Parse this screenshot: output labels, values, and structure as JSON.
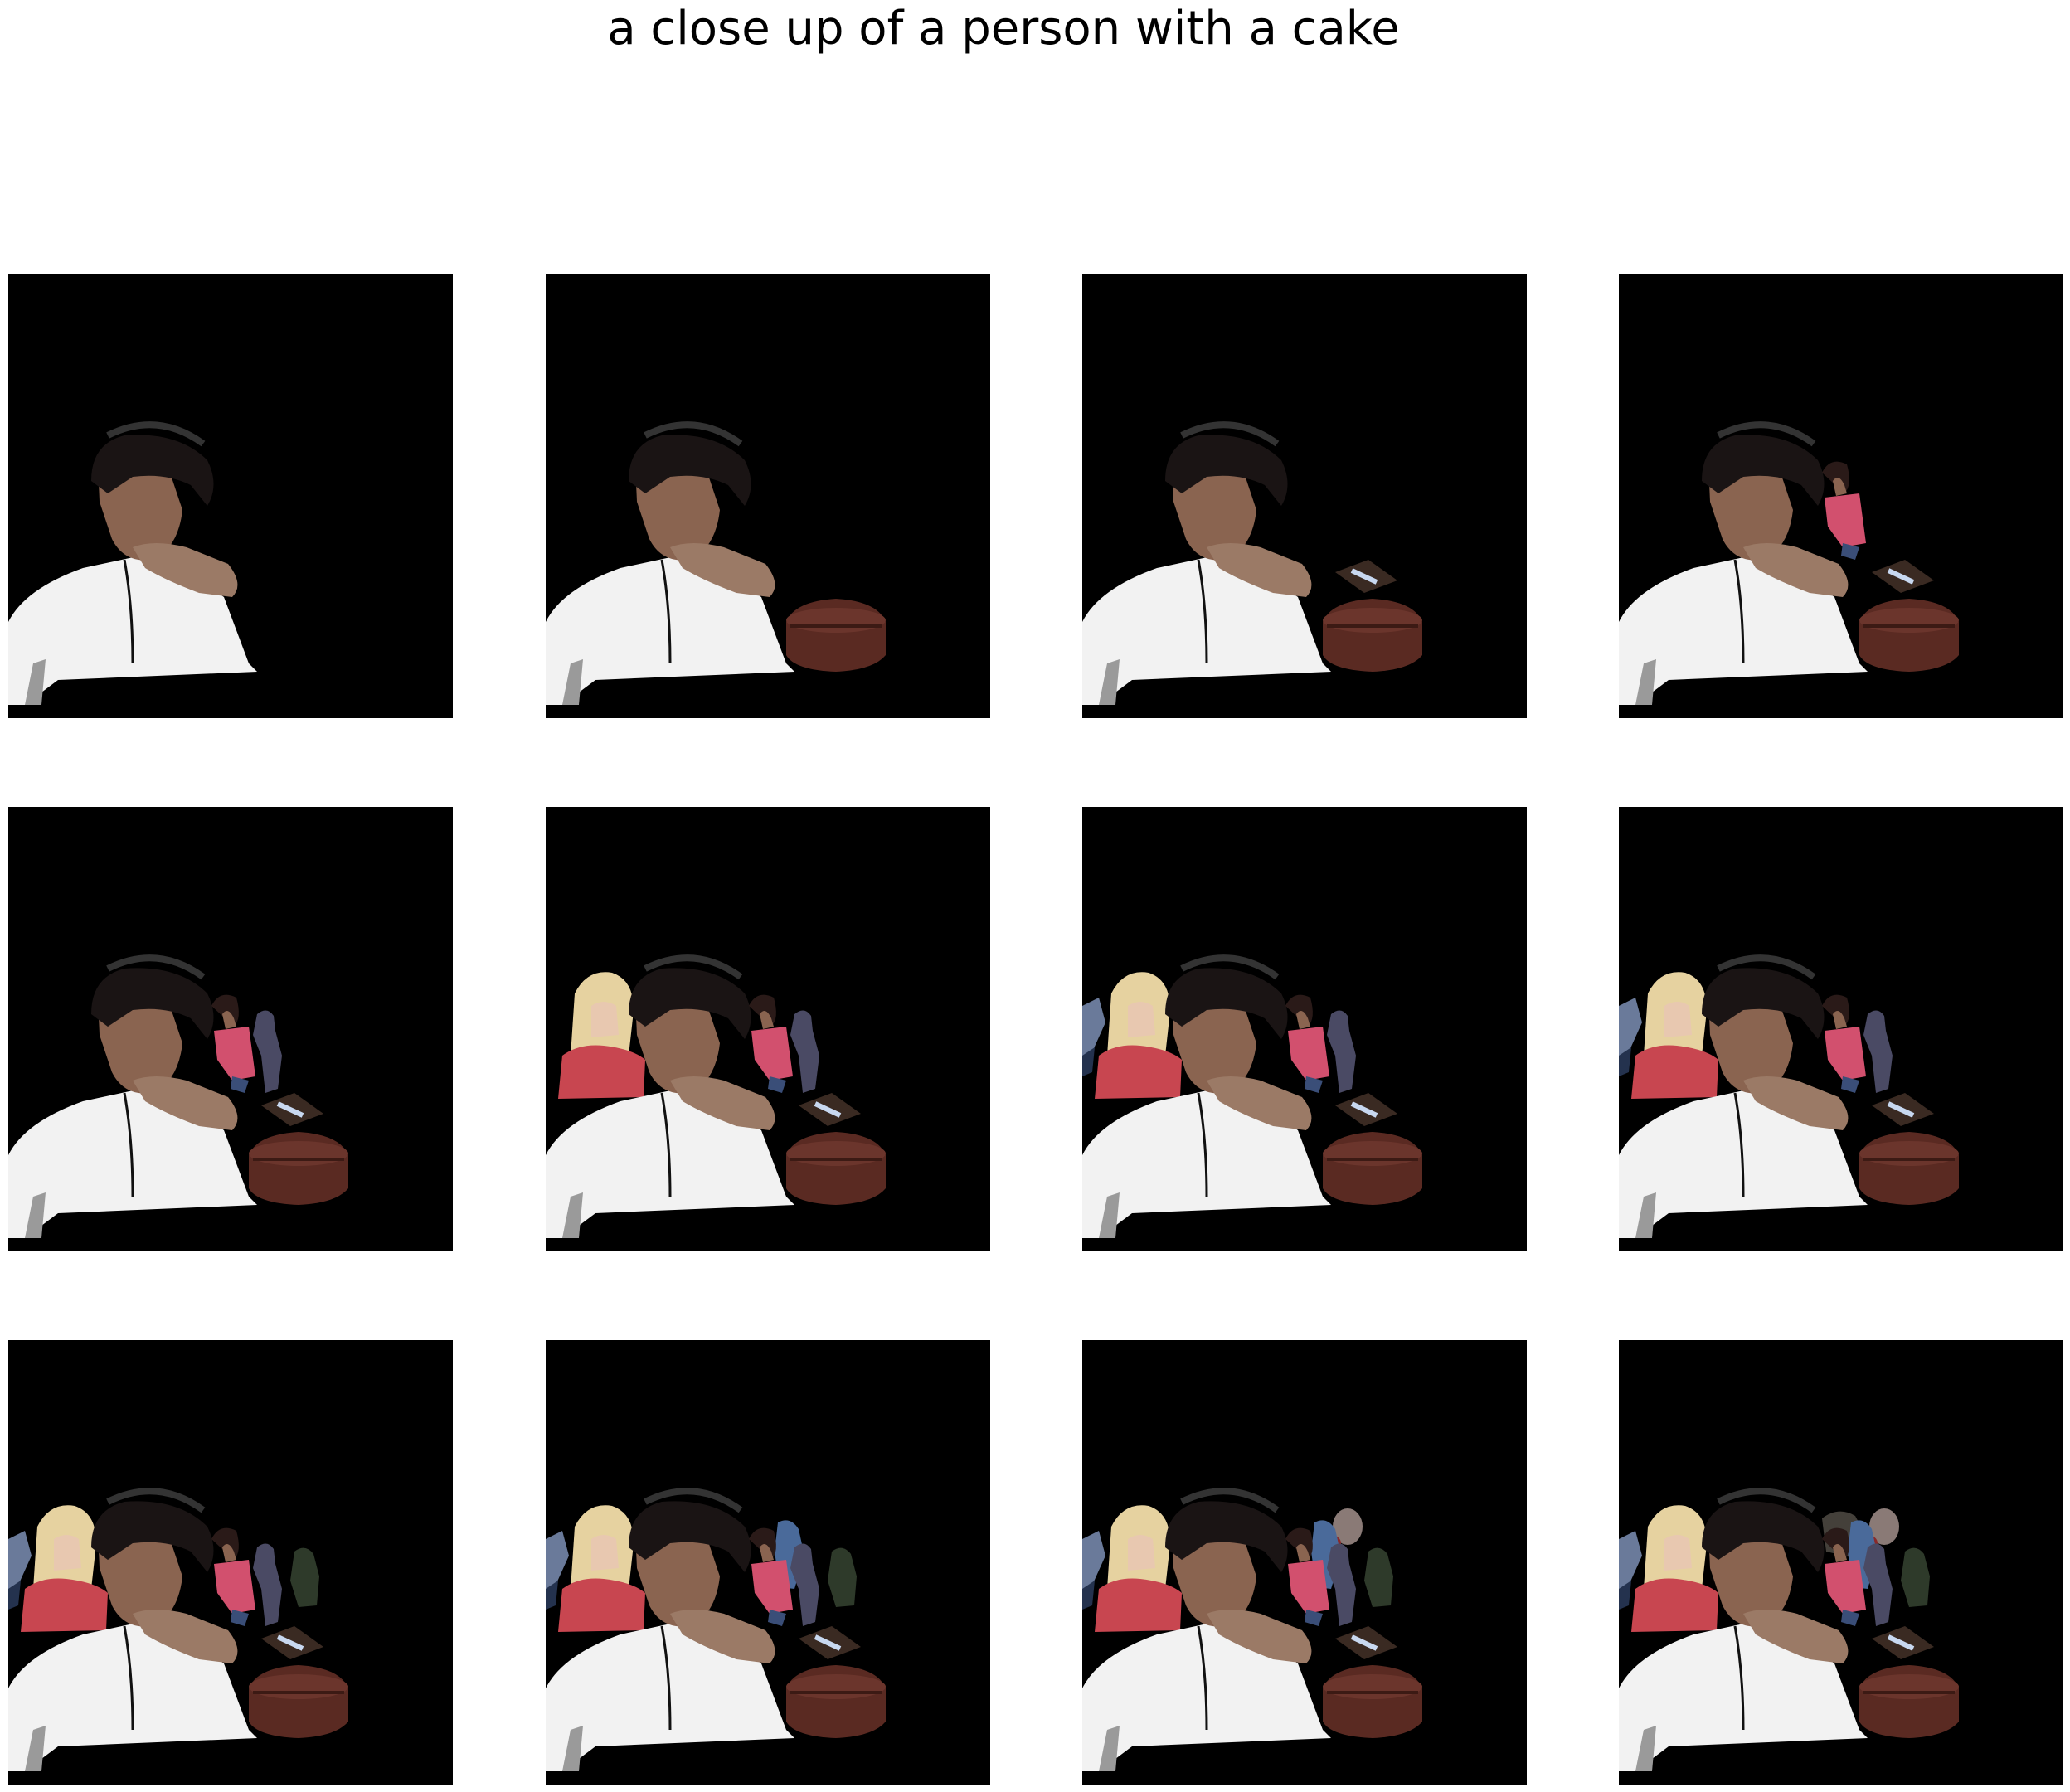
{
  "title": "a close up of a person with a cake",
  "grid": {
    "rows": 3,
    "cols": 4
  },
  "panels": [
    {
      "step": 1,
      "objects": [
        "man"
      ]
    },
    {
      "step": 2,
      "objects": [
        "man",
        "cake"
      ]
    },
    {
      "step": 3,
      "objects": [
        "man",
        "cake",
        "knife"
      ]
    },
    {
      "step": 4,
      "objects": [
        "man",
        "cake",
        "knife",
        "woman"
      ]
    },
    {
      "step": 5,
      "objects": [
        "man",
        "cake",
        "knife",
        "woman",
        "figure"
      ]
    },
    {
      "step": 6,
      "objects": [
        "man",
        "cake",
        "knife",
        "woman",
        "figure",
        "girl"
      ]
    },
    {
      "step": 7,
      "objects": [
        "man",
        "cake",
        "knife",
        "woman",
        "figure",
        "girl",
        "blue-fragment"
      ]
    },
    {
      "step": 8,
      "objects": [
        "man",
        "cake",
        "knife",
        "woman",
        "figure",
        "girl",
        "blue-fragment"
      ]
    },
    {
      "step": 9,
      "objects": [
        "man",
        "cake",
        "knife",
        "woman",
        "figure",
        "girl",
        "blue-fragment",
        "dark-figure"
      ]
    },
    {
      "step": 10,
      "objects": [
        "man",
        "cake",
        "knife",
        "woman",
        "figure",
        "girl",
        "blue-fragment",
        "dark-figure",
        "blue-person"
      ]
    },
    {
      "step": 11,
      "objects": [
        "man",
        "cake",
        "knife",
        "woman",
        "figure",
        "girl",
        "blue-fragment",
        "dark-figure",
        "blue-person",
        "blurred-face"
      ]
    },
    {
      "step": 12,
      "objects": [
        "man",
        "cake",
        "knife",
        "woman",
        "figure",
        "girl",
        "blue-fragment",
        "dark-figure",
        "blue-person",
        "blurred-face",
        "crouching-person"
      ]
    }
  ],
  "colors": {
    "background": "#000000",
    "shirt": "#f2f2f2",
    "skin": "#8a6450",
    "hair": "#1a1414",
    "cake": "#5a2a22",
    "woman_top": "#d2506e",
    "girl_hair": "#e6d2a0",
    "girl_top": "#c84650",
    "figure": "#4a4a64"
  }
}
